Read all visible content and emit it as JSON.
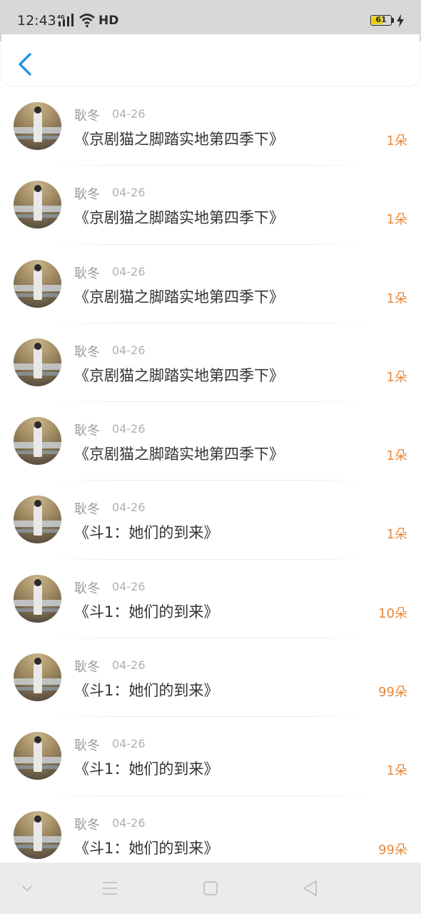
{
  "status_bar": {
    "time": "12:43",
    "network": "4G",
    "hd": "HD",
    "battery": "61",
    "battery_level": 0.61,
    "battery_color": "#f0d000"
  },
  "header": {
    "back_icon": "chevron-left-icon",
    "accent_color": "#2196e8"
  },
  "list": {
    "amount_color": "#e8883a",
    "items": [
      {
        "name": "耿冬",
        "date": "04-26",
        "title": "《京剧猫之脚踏实地第四季下》",
        "amount": "1朵"
      },
      {
        "name": "耿冬",
        "date": "04-26",
        "title": "《京剧猫之脚踏实地第四季下》",
        "amount": "1朵"
      },
      {
        "name": "耿冬",
        "date": "04-26",
        "title": "《京剧猫之脚踏实地第四季下》",
        "amount": "1朵"
      },
      {
        "name": "耿冬",
        "date": "04-26",
        "title": "《京剧猫之脚踏实地第四季下》",
        "amount": "1朵"
      },
      {
        "name": "耿冬",
        "date": "04-26",
        "title": "《京剧猫之脚踏实地第四季下》",
        "amount": "1朵"
      },
      {
        "name": "耿冬",
        "date": "04-26",
        "title": "《斗1：她们的到来》",
        "amount": "1朵"
      },
      {
        "name": "耿冬",
        "date": "04-26",
        "title": "《斗1：她们的到来》",
        "amount": "10朵"
      },
      {
        "name": "耿冬",
        "date": "04-26",
        "title": "《斗1：她们的到来》",
        "amount": "99朵"
      },
      {
        "name": "耿冬",
        "date": "04-26",
        "title": "《斗1：她们的到来》",
        "amount": "1朵"
      },
      {
        "name": "耿冬",
        "date": "04-26",
        "title": "《斗1：她们的到来》",
        "amount": "99朵"
      }
    ]
  },
  "nav_bar": {
    "buttons": [
      "chevron-down-icon",
      "menu-icon",
      "home-square-icon",
      "back-triangle-icon"
    ]
  }
}
